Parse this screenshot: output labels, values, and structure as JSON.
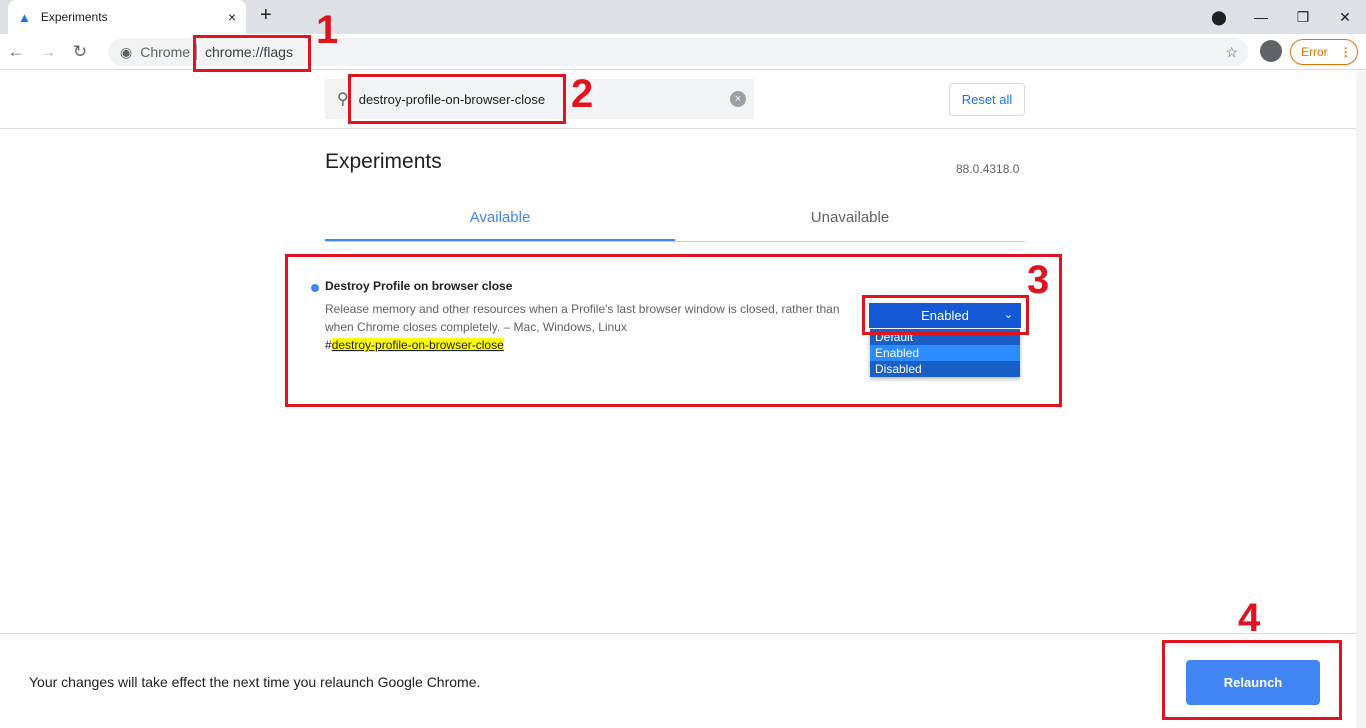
{
  "browser": {
    "tab_title": "Experiments",
    "tab_icon": "flask-icon",
    "site_label": "Chrome",
    "url": "chrome://flags",
    "error_label": "Error",
    "new_tab": "+",
    "close_tab": "×"
  },
  "search": {
    "value": "destroy-profile-on-browser-close",
    "reset_label": "Reset all"
  },
  "page": {
    "title": "Experiments",
    "version": "88.0.4318.0",
    "tabs": [
      {
        "label": "Available",
        "active": true
      },
      {
        "label": "Unavailable",
        "active": false
      }
    ]
  },
  "flag": {
    "name": "Destroy Profile on browser close",
    "description": "Release memory and other resources when a Profile's last browser window is closed, rather than when Chrome closes completely. – Mac, Windows, Linux",
    "hash": "#",
    "anchor": "destroy-profile-on-browser-close",
    "selected": "Enabled",
    "options": [
      "Default",
      "Enabled",
      "Disabled"
    ]
  },
  "footer": {
    "message": "Your changes will take effect the next time you relaunch Google Chrome.",
    "relaunch_label": "Relaunch"
  },
  "annotations": [
    "1",
    "2",
    "3",
    "4"
  ],
  "colors": {
    "accent": "#4285f4",
    "annotation": "#e0141e",
    "highlight": "#ffff00"
  }
}
